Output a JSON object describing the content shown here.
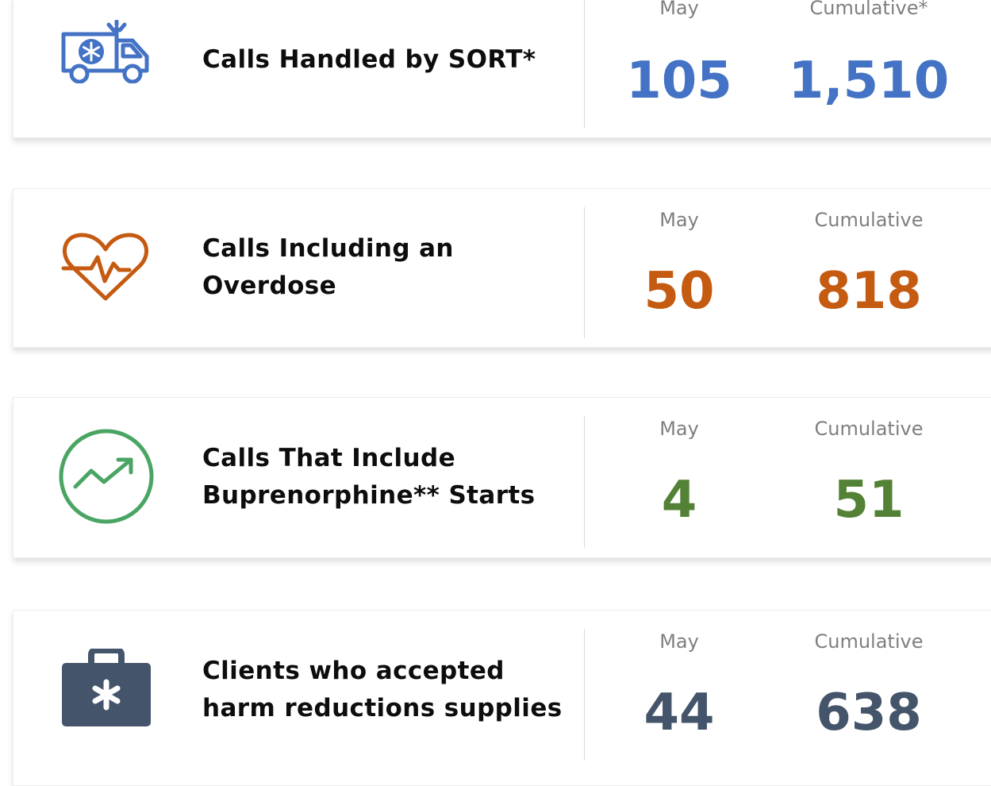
{
  "colors": {
    "blue": "#4472c4",
    "orange": "#c55a11",
    "green": "#538135",
    "icon_green": "#4aa564",
    "slate": "#44546a",
    "label_gray": "#7f7f7f"
  },
  "metrics": [
    {
      "icon": "ambulance-icon",
      "title_lines": [
        "Calls Handled by SORT*"
      ],
      "may_label": "May",
      "cumulative_label": "Cumulative*",
      "may_value": "105",
      "cumulative_value": "1,510",
      "color": "#4472c4"
    },
    {
      "icon": "heart-pulse-icon",
      "title_lines": [
        "Calls Including an",
        "Overdose"
      ],
      "may_label": "May",
      "cumulative_label": "Cumulative",
      "may_value": "50",
      "cumulative_value": "818",
      "color": "#c55a11"
    },
    {
      "icon": "trend-up-icon",
      "title_lines": [
        "Calls That Include",
        "Buprenorphine** Starts"
      ],
      "may_label": "May",
      "cumulative_label": "Cumulative",
      "may_value": "4",
      "cumulative_value": "51",
      "color": "#538135"
    },
    {
      "icon": "medical-kit-icon",
      "title_lines": [
        "Clients who accepted",
        "harm reductions supplies"
      ],
      "may_label": "May",
      "cumulative_label": "Cumulative",
      "may_value": "44",
      "cumulative_value": "638",
      "color": "#44546a"
    }
  ]
}
